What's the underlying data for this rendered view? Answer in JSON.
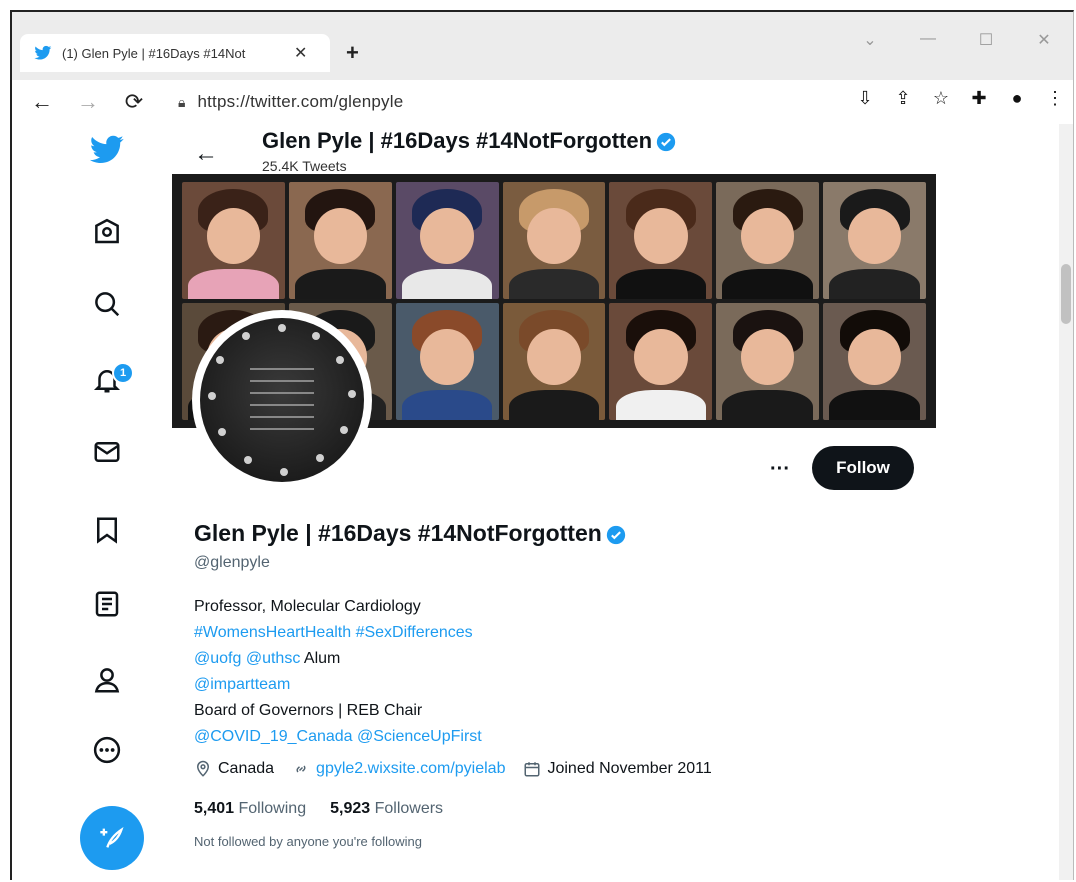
{
  "browser": {
    "tab_title": "(1) Glen Pyle | #16Days #14Not",
    "url": "https://twitter.com/glenpyle"
  },
  "nav": {
    "notification_count": "1"
  },
  "header": {
    "name": "Glen Pyle | #16Days #14NotForgotten",
    "tweet_count": "25.4K Tweets"
  },
  "actions": {
    "more_label": "···",
    "follow_label": "Follow"
  },
  "profile": {
    "name": "Glen Pyle | #16Days #14NotForgotten",
    "handle": "@glenpyle",
    "bio": {
      "line1": "Professor, Molecular Cardiology",
      "hashtag1": "#WomensHeartHealth",
      "hashtag2": "#SexDifferences",
      "mention_uofg": "@uofg",
      "mention_uthsc": "@uthsc",
      "alum": "Alum",
      "mention_impartteam": "@impartteam",
      "line5": "Board of Governors | REB Chair",
      "mention_covid": "@COVID_19_Canada",
      "mention_scienceupfirst": "@ScienceUpFirst"
    },
    "location": "Canada",
    "website": "gpyle2.wixsite.com/pyielab",
    "joined": "Joined November 2011",
    "following_count": "5,401",
    "following_label": "Following",
    "followers_count": "5,923",
    "followers_label": "Followers",
    "not_followed": "Not followed by anyone you're following"
  },
  "colors": {
    "accent": "#1d9bf0",
    "follow_button": "#0f1419"
  }
}
